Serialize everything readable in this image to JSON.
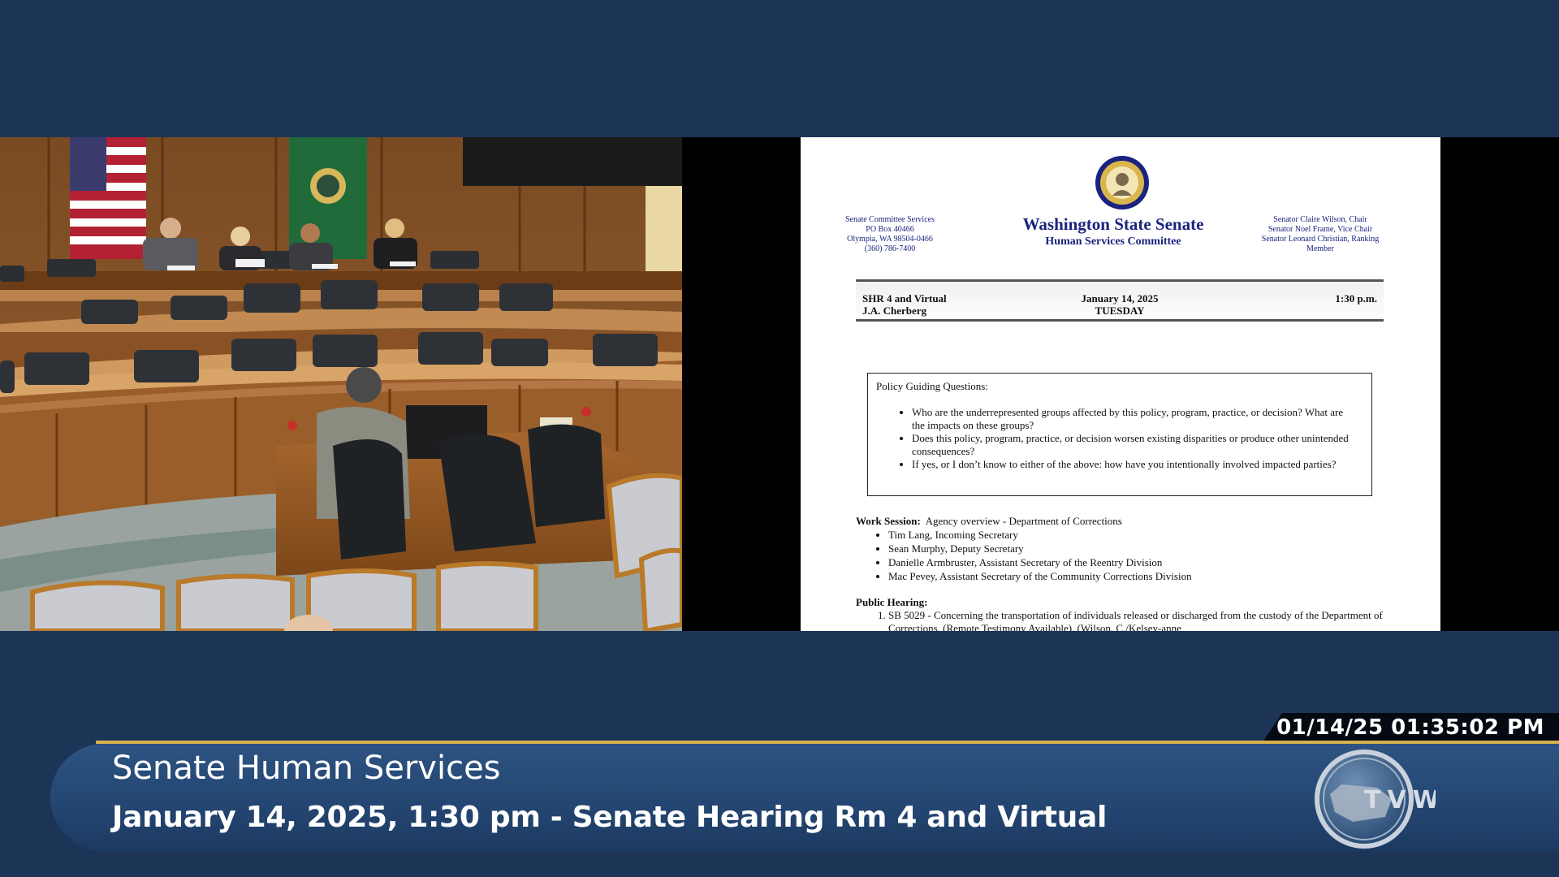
{
  "camera": {
    "description": "Senate hearing room camera feed"
  },
  "document": {
    "org_left": [
      "Senate Committee Services",
      "PO Box 40466",
      "Olympia, WA 98504-0466",
      "(360) 786-7400"
    ],
    "title": "Washington State Senate",
    "subtitle": "Human Services Committee",
    "org_right": [
      "Senator Claire Wilson, Chair",
      "Senator Noel Frame, Vice Chair",
      "Senator Leonard Christian, Ranking",
      "Member"
    ],
    "location_line1": "SHR 4 and Virtual",
    "location_line2": "J.A. Cherberg",
    "date": "January 14, 2025",
    "day": "TUESDAY",
    "time": "1:30  p.m.",
    "policy_title": "Policy Guiding Questions:",
    "policy_questions": [
      "Who are the underrepresented groups affected by this policy, program, practice, or decision?  What are the impacts on these groups?",
      "Does this policy, program, practice, or decision worsen existing disparities or produce other unintended consequences?",
      "If yes, or I don’t know to either of the above: how have you intentionally involved impacted parties?"
    ],
    "work_session_label": "Work Session:",
    "work_session_topic": "Agency overview - Department of Corrections",
    "work_session_items": [
      "Tim Lang, Incoming Secretary",
      "Sean Murphy, Deputy Secretary",
      "Danielle Armbruster, Assistant Secretary of the Reentry Division",
      "Mac Pevey, Assistant Secretary of the Community Corrections Division"
    ],
    "public_hearing_label": "Public Hearing:",
    "public_hearing_items": [
      "SB 5029 - Concerning the transportation of individuals released or discharged from the custody of the Department of Corrections. (Remote Testimony Available). (Wilson, C./Kelsey-anne"
    ]
  },
  "broadcast": {
    "timestamp": "01/14/25 01:35:02 PM",
    "program_title": "Senate Human Services",
    "program_details": "January 14, 2025, 1:30 pm - Senate Hearing Rm 4 and Virtual",
    "logo_text": "TVW",
    "accent_color": "#d8b24a",
    "background_color": "#1c3557"
  }
}
